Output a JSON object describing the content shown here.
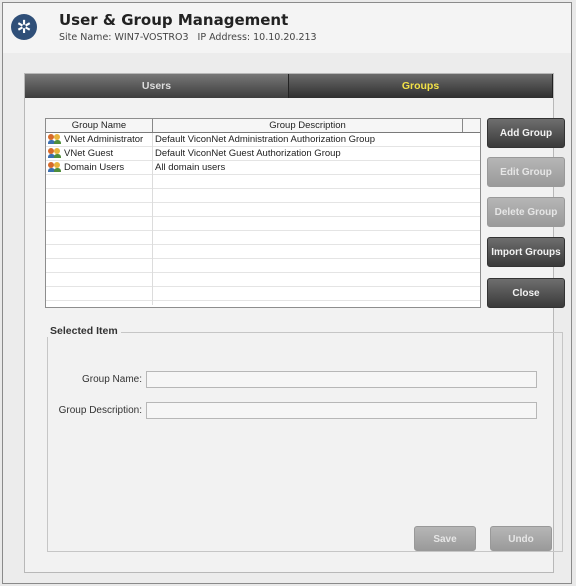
{
  "header": {
    "title": "User & Group Management",
    "site_label": "Site Name: WIN7-VOSTRO3",
    "ip_label": "IP Address: 10.10.20.213"
  },
  "tabs": [
    {
      "label": "Users",
      "active": false
    },
    {
      "label": "Groups",
      "active": true
    }
  ],
  "grid": {
    "columns": [
      "Group Name",
      "Group Description"
    ],
    "rows": [
      {
        "name": "VNet Administrator",
        "description": "Default ViconNet Administration Authorization Group"
      },
      {
        "name": "VNet Guest",
        "description": "Default ViconNet Guest Authorization Group"
      },
      {
        "name": "Domain Users",
        "description": "All domain users"
      }
    ]
  },
  "buttons": {
    "add_group": "Add Group",
    "edit_group": "Edit Group",
    "delete_group": "Delete Group",
    "import_groups": "Import Groups",
    "close": "Close",
    "save": "Save",
    "undo": "Undo"
  },
  "selected_item": {
    "legend": "Selected Item",
    "group_name_label": "Group Name:",
    "group_name_value": "",
    "group_description_label": "Group Description:",
    "group_description_value": ""
  },
  "colors": {
    "active_tab_text": "#f3e247",
    "button_dark": "#3a3a3a",
    "button_disabled": "#a6a6a6"
  },
  "icons": {
    "app": "gear-icon",
    "group": "group-icon"
  }
}
